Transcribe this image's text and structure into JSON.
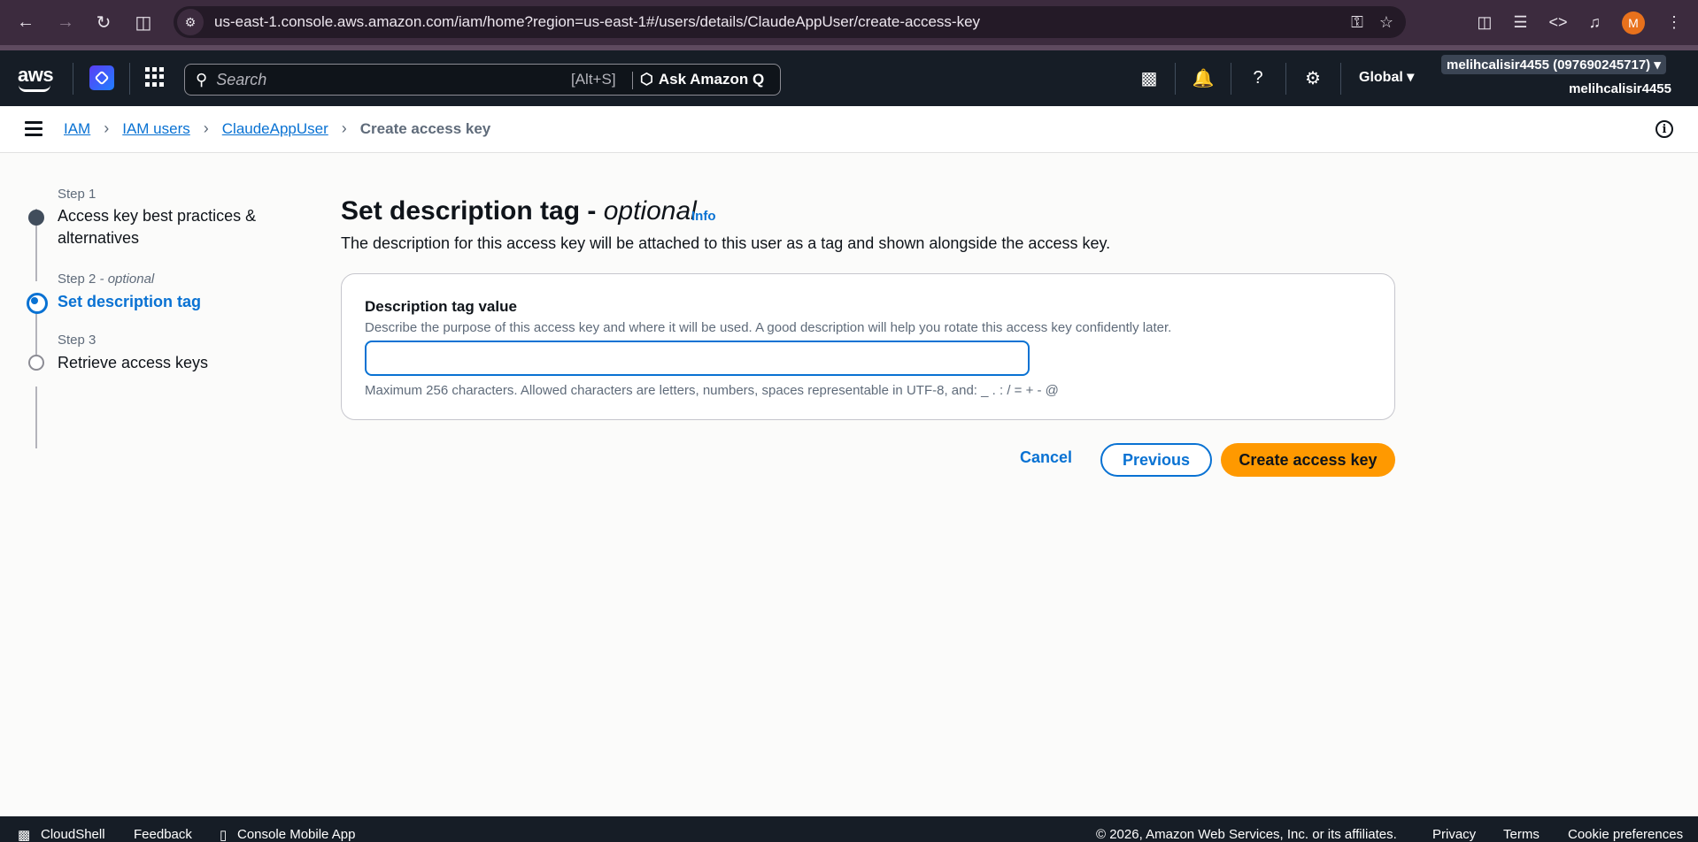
{
  "browser": {
    "url": "us-east-1.console.aws.amazon.com/iam/home?region=us-east-1#/users/details/ClaudeAppUser/create-access-key",
    "profile_initial": "M"
  },
  "aws_nav": {
    "logo": "aws",
    "search_placeholder": "Search",
    "search_shortcut": "[Alt+S]",
    "ask_q": "Ask Amazon Q",
    "region": "Global",
    "account_chip": "melihcalisir4455 (097690245717)",
    "account_user": "melihcalisir4455"
  },
  "breadcrumb": {
    "items": [
      "IAM",
      "IAM users",
      "ClaudeAppUser"
    ],
    "current": "Create access key"
  },
  "steps": [
    {
      "num": "Step 1",
      "title": "Access key best practices & alternatives",
      "state": "done"
    },
    {
      "num": "Step 2",
      "num_suffix": "- optional",
      "title": "Set description tag",
      "state": "active"
    },
    {
      "num": "Step 3",
      "title": "Retrieve access keys",
      "state": "todo"
    }
  ],
  "main": {
    "title": "Set description tag -",
    "title_optional": "optional",
    "info": "Info",
    "description": "The description for this access key will be attached to this user as a tag and shown alongside the access key."
  },
  "form": {
    "label": "Description tag value",
    "description": "Describe the purpose of this access key and where it will be used. A good description will help you rotate this access key confidently later.",
    "value": "",
    "constraint": "Maximum 256 characters. Allowed characters are letters, numbers, spaces representable in UTF-8, and: _ . : / = + - @"
  },
  "actions": {
    "cancel": "Cancel",
    "previous": "Previous",
    "create": "Create access key"
  },
  "footer": {
    "cloudshell": "CloudShell",
    "feedback": "Feedback",
    "mobile_app": "Console Mobile App",
    "copyright": "© 2026, Amazon Web Services, Inc. or its affiliates.",
    "privacy": "Privacy",
    "terms": "Terms",
    "cookie": "Cookie preferences"
  },
  "colors": {
    "accent": "#0972d3",
    "primary_button": "#ff9900",
    "nav_bg": "#161d26",
    "browser_bg": "#3c2b3e"
  }
}
